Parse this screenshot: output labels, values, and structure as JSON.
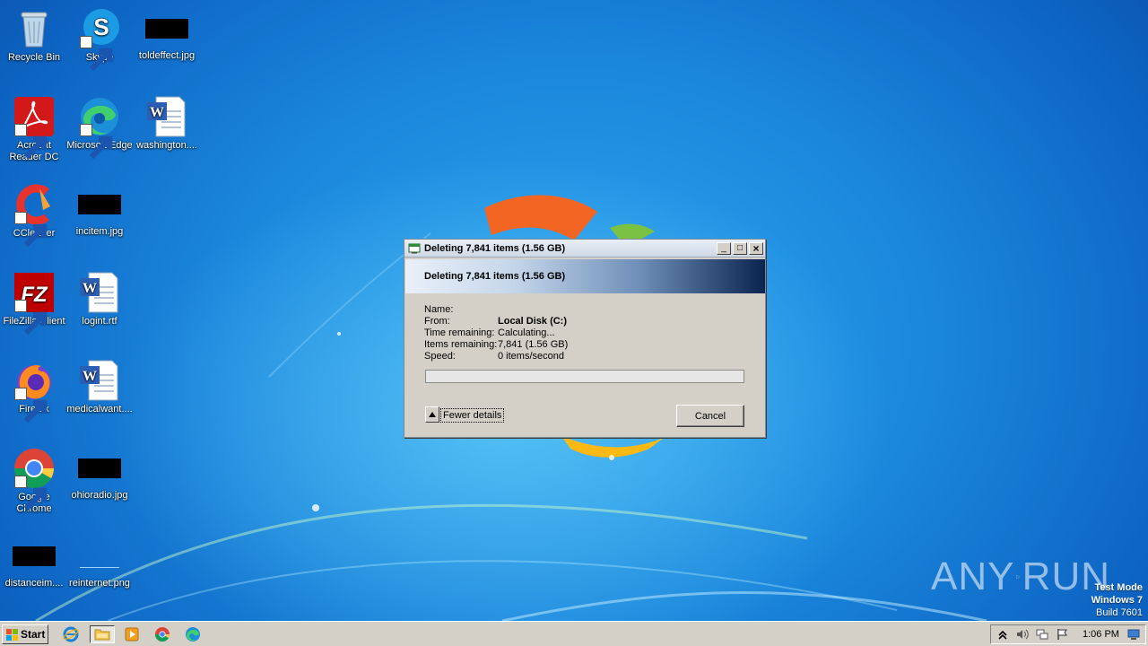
{
  "desktop": {
    "icons": [
      {
        "label": "Recycle Bin",
        "icon": "recycle-bin-icon"
      },
      {
        "label": "Skype",
        "icon": "skype-icon"
      },
      {
        "label": "toldeffect.jpg",
        "icon": "image-file-icon"
      },
      {
        "label": "Acrobat Reader DC",
        "icon": "acrobat-icon"
      },
      {
        "label": "Microsoft Edge",
        "icon": "edge-icon"
      },
      {
        "label": "washington....",
        "icon": "word-doc-icon"
      },
      {
        "label": "CCleaner",
        "icon": "ccleaner-icon"
      },
      {
        "label": "incitem.jpg",
        "icon": "image-file-icon"
      },
      {
        "label": "FileZilla Client",
        "icon": "filezilla-icon"
      },
      {
        "label": "logint.rtf",
        "icon": "word-doc-icon"
      },
      {
        "label": "Firefox",
        "icon": "firefox-icon"
      },
      {
        "label": "medicalwant....",
        "icon": "word-doc-icon"
      },
      {
        "label": "Google Chrome",
        "icon": "chrome-icon"
      },
      {
        "label": "ohioradio.jpg",
        "icon": "image-file-icon"
      },
      {
        "label": "distanceim....",
        "icon": "image-file-icon"
      },
      {
        "label": "reinternet.png",
        "icon": "image-file-icon"
      }
    ]
  },
  "dialog": {
    "title": "Deleting 7,841 items (1.56 GB)",
    "heading": "Deleting 7,841 items (1.56 GB)",
    "rows": [
      {
        "label": "Name:",
        "value": ""
      },
      {
        "label": "From:",
        "value": "Local Disk (C:)"
      },
      {
        "label": "Time remaining:",
        "value": "Calculating..."
      },
      {
        "label": "Items remaining:",
        "value": "7,841 (1.56 GB)"
      },
      {
        "label": "Speed:",
        "value": "0 items/second"
      }
    ],
    "progress": 0,
    "fewer_details_label": "Fewer details",
    "cancel_label": "Cancel",
    "minimize": "_",
    "maximize": "□",
    "close": "×"
  },
  "watermark": {
    "text_left": "ANY",
    "text_right": "RUN"
  },
  "system": {
    "test_mode": "Test Mode",
    "os_name": "Windows 7",
    "build": "Build 7601"
  },
  "taskbar": {
    "start_label": "Start",
    "pinned": [
      "internet-explorer-icon",
      "explorer-folder-icon",
      "media-player-icon",
      "chrome-icon",
      "edge-icon"
    ],
    "clock": "1:06 PM",
    "tray": [
      "chevron-up-icon",
      "volume-icon",
      "network-icon",
      "flag-icon",
      "desktop-icon"
    ]
  }
}
